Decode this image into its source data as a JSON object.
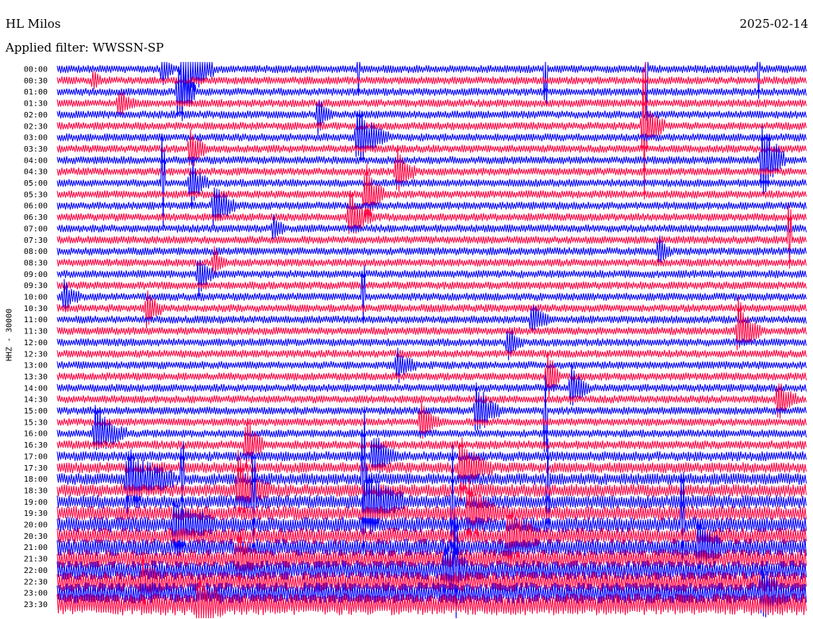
{
  "header": {
    "station": "HL Milos",
    "filter": "Applied filter: WWSSN-SP",
    "date": "2025-02-14",
    "channel": "HHZ - 30000"
  },
  "colors": {
    "odd_trace": "#0000ff",
    "even_trace": "#ff0040",
    "background": "#ffffff"
  },
  "chart_data": {
    "type": "line",
    "title": "HL Milos",
    "subtitle": "Applied filter: WWSSN-SP",
    "ylabel": "HHZ - 30000",
    "xlabel": "",
    "grid": false,
    "legend": "none",
    "row_minutes": 30,
    "rows": [
      "00:00",
      "00:30",
      "01:00",
      "01:30",
      "02:00",
      "02:30",
      "03:00",
      "03:30",
      "04:00",
      "04:30",
      "05:00",
      "05:30",
      "06:00",
      "06:30",
      "07:00",
      "07:30",
      "08:00",
      "08:30",
      "09:00",
      "09:30",
      "10:00",
      "10:30",
      "11:00",
      "11:30",
      "12:00",
      "12:30",
      "13:00",
      "13:30",
      "14:00",
      "14:30",
      "15:00",
      "15:30",
      "16:00",
      "16:30",
      "17:00",
      "17:30",
      "18:00",
      "18:30",
      "19:00",
      "19:30",
      "20:00",
      "20:30",
      "21:00",
      "21:30",
      "22:00",
      "22:30",
      "23:00",
      "23:30"
    ],
    "series": [
      {
        "values": []
      }
    ]
  }
}
